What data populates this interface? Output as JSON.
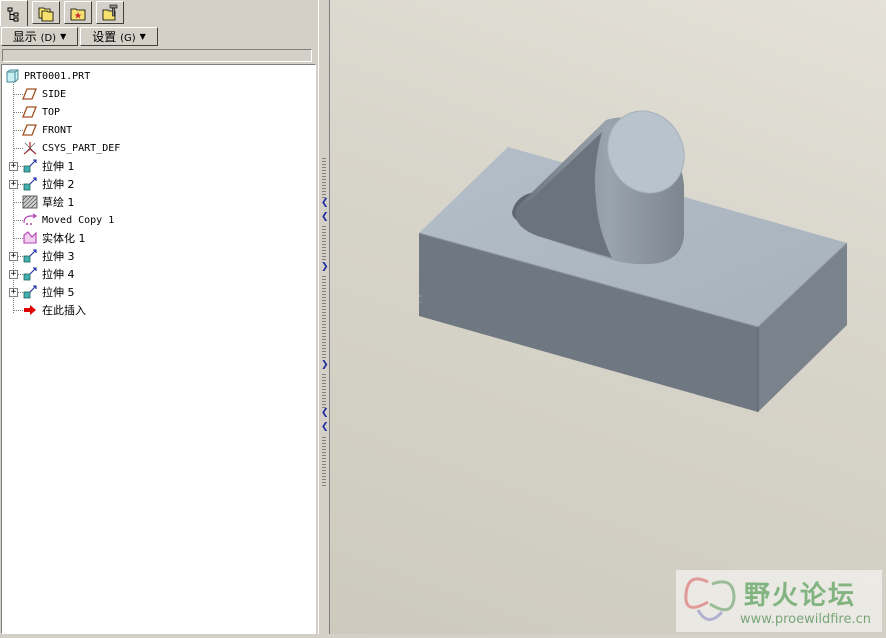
{
  "tabs": [
    {
      "icon": "model-tree-icon",
      "active": true
    },
    {
      "icon": "folder-browser-icon",
      "active": false
    },
    {
      "icon": "favorites-folder-icon",
      "active": false
    },
    {
      "icon": "connections-icon",
      "active": false
    }
  ],
  "menu": {
    "display_label": "显示",
    "display_key": "(D)",
    "settings_label": "设置",
    "settings_key": "(G)"
  },
  "tree": {
    "root": "PRT0001.PRT",
    "items": [
      {
        "label": "SIDE",
        "icon": "datum-plane-icon",
        "expandable": false
      },
      {
        "label": "TOP",
        "icon": "datum-plane-icon",
        "expandable": false
      },
      {
        "label": "FRONT",
        "icon": "datum-plane-icon",
        "expandable": false
      },
      {
        "label": "CSYS_PART_DEF",
        "icon": "coordinate-system-icon",
        "expandable": false
      },
      {
        "label": "拉伸 1",
        "icon": "extrude-icon",
        "expandable": true
      },
      {
        "label": "拉伸 2",
        "icon": "extrude-icon",
        "expandable": true
      },
      {
        "label": "草绘 1",
        "icon": "sketch-icon",
        "expandable": false
      },
      {
        "label": "Moved Copy 1",
        "icon": "moved-copy-icon",
        "expandable": false
      },
      {
        "label": "实体化 1",
        "icon": "solidify-icon",
        "expandable": false
      },
      {
        "label": "拉伸 3",
        "icon": "extrude-icon",
        "expandable": true
      },
      {
        "label": "拉伸 4",
        "icon": "extrude-icon",
        "expandable": true
      },
      {
        "label": "拉伸 5",
        "icon": "extrude-icon",
        "expandable": true
      },
      {
        "label": "在此插入",
        "icon": "insert-here-arrow-icon",
        "expandable": false
      }
    ]
  },
  "watermark": {
    "title": "野火论坛",
    "url": "www.proewildfire.cn"
  },
  "colors": {
    "ui_gray": "#d4d0c8",
    "model_top": "#aeb8c2",
    "model_side": "#6f7780",
    "accent_blue": "#1a2a9c",
    "insert_arrow": "#e00000"
  }
}
